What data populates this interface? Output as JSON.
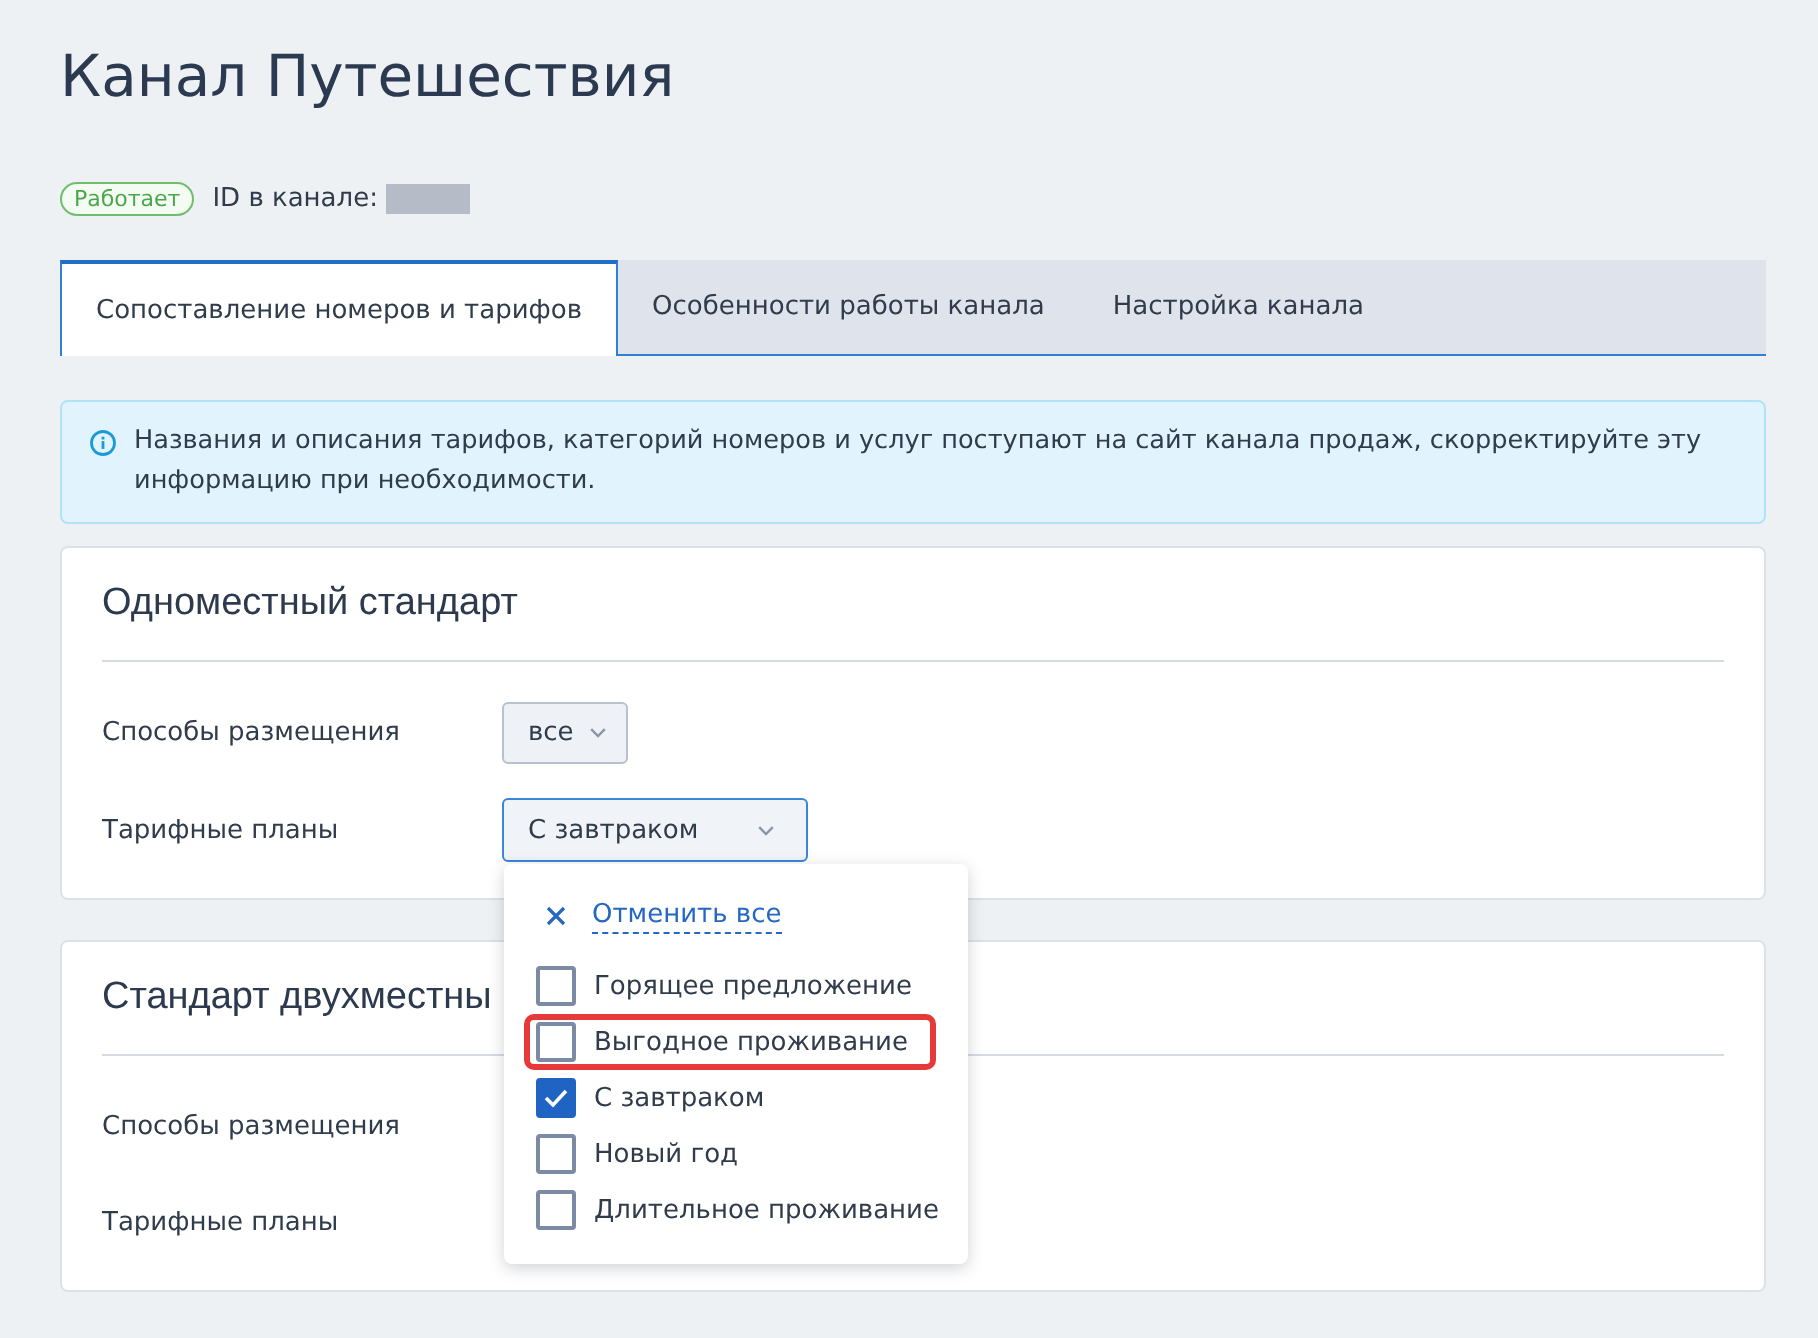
{
  "page": {
    "title": "Канал Путешествия"
  },
  "status": {
    "badge": "Работает",
    "id_label": "ID в канале:"
  },
  "tabs": [
    {
      "label": "Сопоставление номеров и тарифов",
      "selected": true
    },
    {
      "label": "Особенности работы канала",
      "selected": false
    },
    {
      "label": "Настройка канала",
      "selected": false
    }
  ],
  "notice": {
    "text": "Названия и описания тарифов, категорий номеров и услуг поступают на сайт канала продаж, скорректируйте эту информацию при необходимости."
  },
  "rooms": [
    {
      "title": "Одноместный стандарт",
      "fields": [
        {
          "label": "Способы размещения",
          "select": {
            "value": "все",
            "open": false
          }
        },
        {
          "label": "Тарифные планы",
          "select": {
            "value": "С завтраком",
            "open": true,
            "clear_label": "Отменить все",
            "options": [
              {
                "label": "Горящее предложение",
                "checked": false,
                "highlighted": false
              },
              {
                "label": "Выгодное проживание",
                "checked": false,
                "highlighted": true
              },
              {
                "label": "С завтраком",
                "checked": true,
                "highlighted": false
              },
              {
                "label": "Новый год",
                "checked": false,
                "highlighted": false
              },
              {
                "label": "Длительное проживание",
                "checked": false,
                "highlighted": false
              }
            ]
          }
        }
      ]
    },
    {
      "title": "Стандарт двухместны",
      "fields": [
        {
          "label": "Способы размещения"
        },
        {
          "label": "Тарифные планы"
        }
      ]
    }
  ]
}
